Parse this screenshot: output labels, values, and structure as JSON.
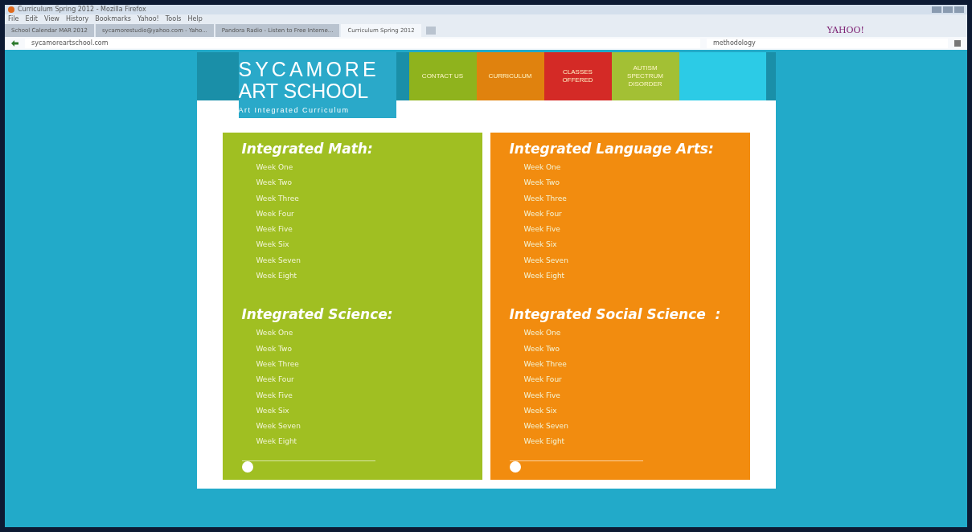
{
  "browser": {
    "title": "Curriculum Spring 2012 - Mozilla Firefox",
    "menu": [
      "File",
      "Edit",
      "View",
      "History",
      "Bookmarks",
      "Yahoo!",
      "Tools",
      "Help"
    ],
    "tabs": [
      {
        "label": "School Calendar MAR 2012",
        "selected": false
      },
      {
        "label": "sycamorestudio@yahoo.com - Yaho...",
        "selected": false
      },
      {
        "label": "Pandora Radio - Listen to Free Interne...",
        "selected": false
      },
      {
        "label": "Curriculum Spring 2012",
        "selected": true
      }
    ],
    "url": "sycamoreartschool.com",
    "search": "methodology",
    "brand": "YAHOO!"
  },
  "site": {
    "logo": {
      "line1": "SYCAMORE",
      "line2": "ART SCHOOL",
      "tagline": "Art Integrated Curriculum"
    },
    "nav": [
      {
        "label": "CONTACT US",
        "color": "#8fb31d"
      },
      {
        "label": "CURRICULUM",
        "color": "#e0820e"
      },
      {
        "label": "CLASSES OFFERED",
        "color": "#d42a26"
      },
      {
        "label": "AUTISM SPECTRUM DISORDER",
        "color": "#a3c034"
      }
    ],
    "panels": [
      {
        "color": "#a0bf22",
        "sections": [
          {
            "title": "Integrated Math:",
            "weeks": [
              "Week One",
              "Week Two",
              "Week Three",
              "Week Four",
              "Week Five",
              "Week Six",
              "Week Seven",
              "Week Eight"
            ]
          },
          {
            "title": "Integrated Science:",
            "weeks": [
              "Week One",
              "Week Two",
              "Week Three",
              "Week Four",
              "Week Five",
              "Week Six",
              "Week Seven",
              "Week Eight"
            ]
          }
        ],
        "slider": {
          "level": 0
        }
      },
      {
        "color": "#f28c0f",
        "sections": [
          {
            "title": "Integrated Language Arts:",
            "weeks": [
              "Week One",
              "Week Two",
              "Week Three",
              "Week Four",
              "Week Five",
              "Week Six",
              "Week Seven",
              "Week Eight"
            ]
          },
          {
            "title": "Integrated Social Science  :",
            "weeks": [
              "Week One",
              "Week Two",
              "Week Three",
              "Week Four",
              "Week Five",
              "Week Six",
              "Week Seven",
              "Week Eight"
            ]
          }
        ],
        "slider": {
          "level": 0
        }
      }
    ]
  }
}
